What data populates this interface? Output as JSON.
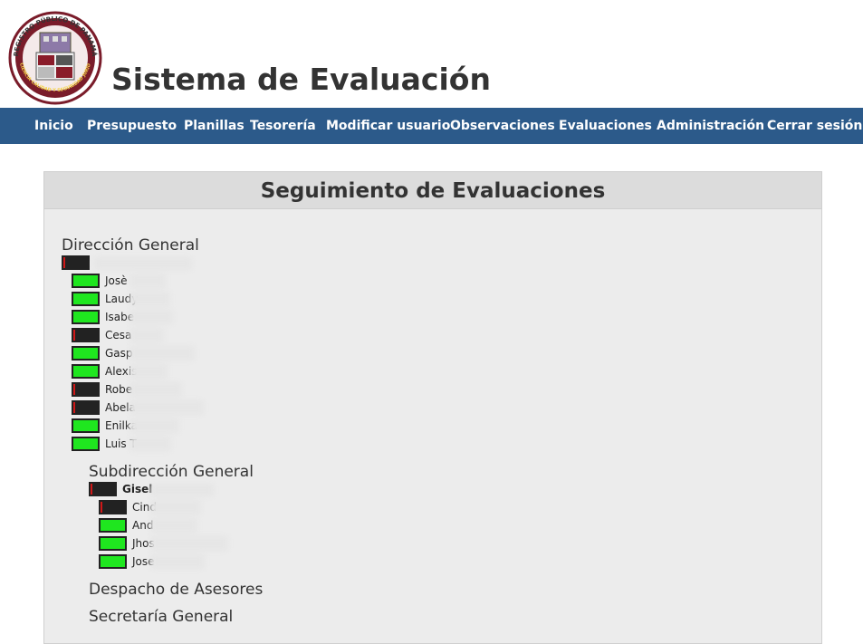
{
  "header": {
    "app_title": "Sistema de Evaluación",
    "logo": {
      "icon": "registro-publico-seal-icon",
      "ring_text": "REGISTRO PÚBLICO DE PANAMÁ",
      "motto": "EFICIENCIA CALIDAD Y SEGURIDAD JURÍDICA"
    }
  },
  "nav": {
    "items": [
      {
        "label": "Inicio"
      },
      {
        "label": "Presupuesto"
      },
      {
        "label": "Planillas"
      },
      {
        "label": "Tesorería"
      },
      {
        "label": "Modificar usuario"
      },
      {
        "label": "Observaciones"
      },
      {
        "label": "Evaluaciones"
      },
      {
        "label": "Administración"
      },
      {
        "label": "Cerrar sesión"
      }
    ]
  },
  "panel": {
    "title": "Seguimiento de Evaluaciones"
  },
  "sections": {
    "direccion_general": {
      "title": "Dirección General",
      "head": {
        "name": "",
        "progress": 0.05
      },
      "members": [
        {
          "name": "Josè",
          "progress": 1
        },
        {
          "name": "Laudy",
          "progress": 1
        },
        {
          "name": "Isabe",
          "progress": 1
        },
        {
          "name": "Cesa",
          "progress": 0.05
        },
        {
          "name": "Gasp",
          "progress": 1
        },
        {
          "name": "Alexis",
          "progress": 1
        },
        {
          "name": "Robe",
          "progress": 0.05
        },
        {
          "name": "Abela",
          "progress": 0.05
        },
        {
          "name": "Enilka",
          "progress": 1
        },
        {
          "name": "Luis T",
          "progress": 1
        }
      ]
    },
    "subdireccion_general": {
      "title": "Subdirección General",
      "head": {
        "name": "Gisel",
        "progress": 0.05
      },
      "members": [
        {
          "name": "Cind",
          "progress": 0.05
        },
        {
          "name": "And",
          "progress": 1
        },
        {
          "name": "Jhos",
          "progress": 1
        },
        {
          "name": "Jose",
          "progress": 1
        }
      ]
    },
    "despacho_asesores": {
      "title": "Despacho de Asesores"
    },
    "secretaria_general": {
      "title": "Secretaría General"
    }
  },
  "colors": {
    "nav_bg": "#2c5a8a",
    "complete": "#1fe61f",
    "incomplete": "#d01818",
    "bar_bg": "#222222",
    "panel_bg": "#ececec",
    "panel_head_bg": "#dcdcdc"
  }
}
